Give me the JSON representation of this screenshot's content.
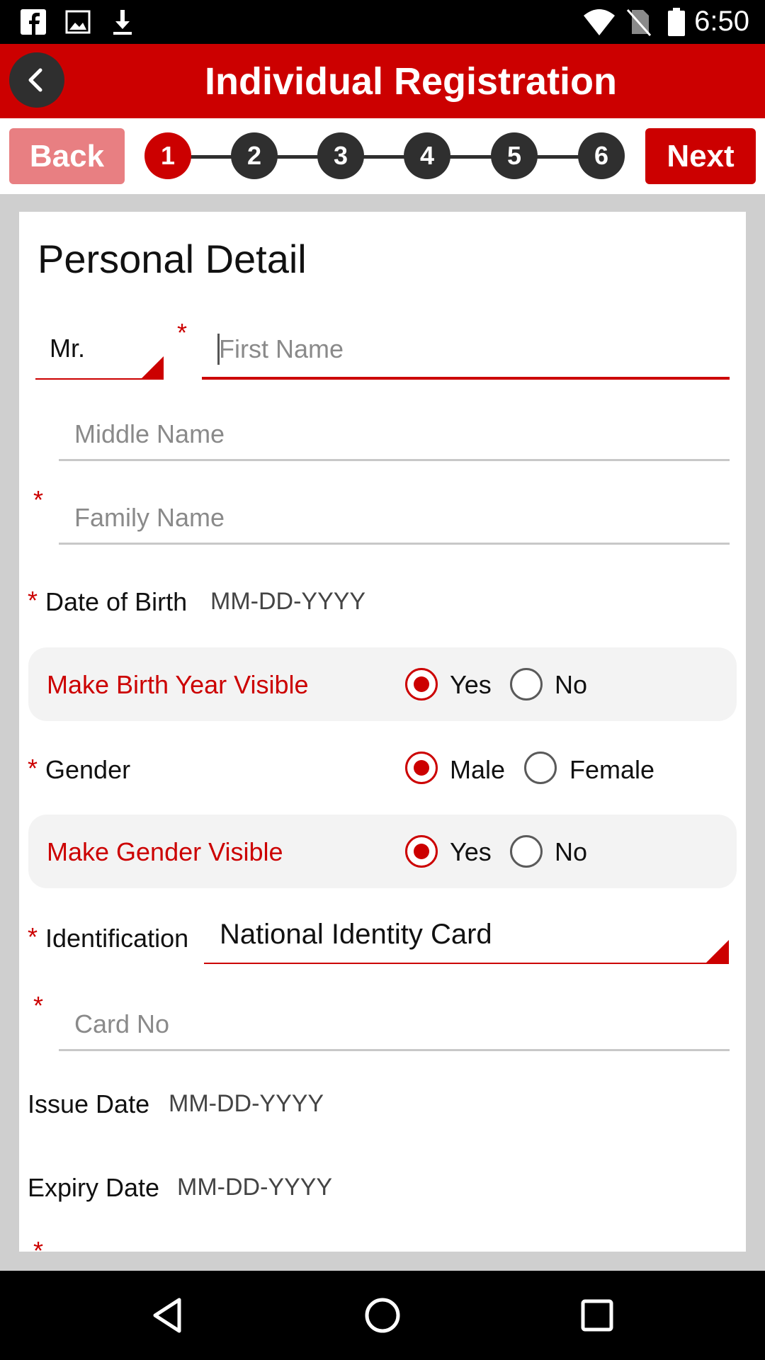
{
  "status_bar": {
    "time": "6:50",
    "left_icons": [
      "facebook-icon",
      "image-icon",
      "download-icon"
    ],
    "right_icons": [
      "wifi-icon",
      "no-sim-icon",
      "battery-icon"
    ]
  },
  "app_bar": {
    "title": "Individual Registration",
    "back_icon": "chevron-left-icon"
  },
  "wizard": {
    "back_label": "Back",
    "next_label": "Next",
    "steps": [
      "1",
      "2",
      "3",
      "4",
      "5",
      "6"
    ],
    "active_step": "1"
  },
  "form": {
    "section_title": "Personal Detail",
    "required_mark": "*",
    "title_select": {
      "value": "Mr."
    },
    "first_name": {
      "placeholder": "First Name",
      "value": ""
    },
    "middle_name": {
      "placeholder": "Middle Name",
      "value": ""
    },
    "family_name": {
      "placeholder": "Family Name",
      "value": ""
    },
    "dob": {
      "label": "Date of Birth",
      "value": "MM-DD-YYYY"
    },
    "birth_year_visible": {
      "label": "Make Birth Year Visible",
      "options": [
        "Yes",
        "No"
      ],
      "selected": "Yes"
    },
    "gender": {
      "label": "Gender",
      "options": [
        "Male",
        "Female"
      ],
      "selected": "Male"
    },
    "gender_visible": {
      "label": "Make Gender Visible",
      "options": [
        "Yes",
        "No"
      ],
      "selected": "Yes"
    },
    "identification": {
      "label": "Identification",
      "value": "National Identity Card"
    },
    "card_no": {
      "placeholder": "Card No",
      "value": ""
    },
    "issue_date": {
      "label": "Issue Date",
      "value": "MM-DD-YYYY"
    },
    "expiry_date": {
      "label": "Expiry Date",
      "value": "MM-DD-YYYY"
    }
  },
  "colors": {
    "brand_red": "#cc0000",
    "back_button_pink": "#e87f82",
    "step_dark": "#2f2f2f",
    "row_gray": "#f3f3f3"
  },
  "nav_bar": {
    "icons": [
      "back-triangle-icon",
      "home-circle-icon",
      "recents-square-icon"
    ]
  }
}
